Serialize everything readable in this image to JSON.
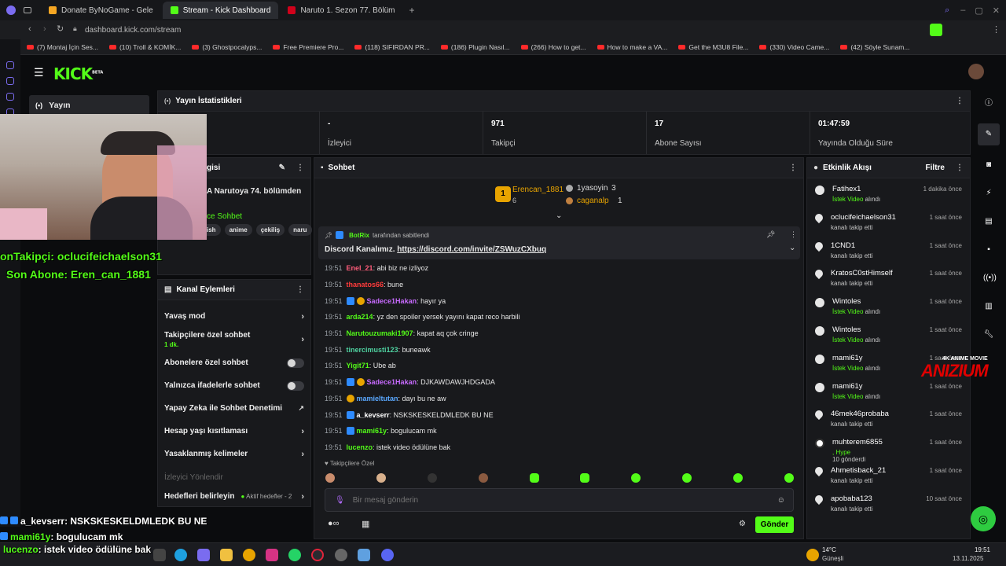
{
  "browser": {
    "tabs": [
      {
        "label": "Donate ByNoGame - Gele",
        "color": "#f5a623"
      },
      {
        "label": "Stream - Kick Dashboard",
        "color": "#53fc18"
      },
      {
        "label": "Naruto 1. Sezon 77. Bölüm",
        "color": "#d0021b"
      }
    ],
    "url": "dashboard.kick.com/stream",
    "bookmarks": [
      "(7) Montaj İçin Ses...",
      "(10) Troll & KOMİK...",
      "(3) Ghostpocalyps...",
      "Free Premiere Pro...",
      "(118) SIFIRDAN PR...",
      "(186) Plugin Nasıl...",
      "(266) How to get...",
      "How to make a VA...",
      "Get the M3U8 File...",
      "(330) Video Came...",
      "(42) Söyle Sunam..."
    ]
  },
  "brand": {
    "logo": "KICK",
    "beta": "BETA",
    "accent": "#53fc18"
  },
  "sidebar": {
    "stream_item": "Yayın"
  },
  "stats_panel": {
    "title": "Yayın İstatistikleri",
    "stats": [
      {
        "value": "-",
        "label": "İzleyici"
      },
      {
        "value": "971",
        "label": "Takipçi"
      },
      {
        "value": "17",
        "label": "Abone Sayısı"
      },
      {
        "value": "01:47:59",
        "label": "Yayında Olduğu Süre"
      }
    ]
  },
  "stream_info": {
    "title_partial": "gisi",
    "stream_title": "A Narutoya 74. bölümden",
    "category": "ce Sohbet",
    "tags": [
      "ish",
      "anime",
      "çekiliş",
      "naru"
    ]
  },
  "overlay": {
    "last_follower": "onTakipçi: oclucifeichaelson31",
    "last_sub": "Son Abone: Eren_can_1881",
    "chat_lines": [
      {
        "user": "a_kevserr",
        "text": ": NSKSKESKELDMLEDK BU NE"
      },
      {
        "user": "mami61y",
        "text": ": bogulucam mk"
      },
      {
        "user": "lucenzo",
        "text": ": istek video ödülüne bak"
      }
    ],
    "watermark_small": "4K ANIME MOVIE",
    "watermark": "ANIZIUM"
  },
  "channel_actions": {
    "title": "Kanal Eylemleri",
    "items": [
      {
        "label": "Yavaş mod",
        "control": "chevron"
      },
      {
        "label": "Takipçilere özel sohbet",
        "sub": "1 dk.",
        "control": "chevron"
      },
      {
        "label": "Abonelere özel sohbet",
        "control": "toggle"
      },
      {
        "label": "Yalnızca ifadelerle sohbet",
        "control": "toggle"
      },
      {
        "label": "Yapay Zeka ile Sohbet Denetimi",
        "control": "link"
      },
      {
        "label": "Hesap yaşı kısıtlaması",
        "control": "chevron"
      },
      {
        "label": "Yasaklanmış kelimeler",
        "control": "chevron"
      }
    ],
    "section_label": "İzleyici Yönlendir",
    "goals_label": "Hedefleri belirleyin",
    "goals_status": "Aktif hedefler - 2"
  },
  "chat": {
    "title": "Sohbet",
    "top_gifters": [
      {
        "rank": "1",
        "name": "Erencan_1881",
        "count": "6"
      },
      {
        "rank": "",
        "name": "1yasoyin",
        "count": "3"
      },
      {
        "rank": "",
        "name": "caganalp",
        "count": "1"
      }
    ],
    "pinned_by": "BotRix",
    "pinned_suffix": "tarafından sabitlendi",
    "pinned_text": "Discord Kanalımız.",
    "pinned_link": "https://discord.com/invite/ZSWuzCXbuq",
    "messages": [
      {
        "time": "19:51",
        "user": "Enel_21",
        "color": "#ff5c7a",
        "text": ": abi biz ne izliyoz",
        "badges": []
      },
      {
        "time": "19:51",
        "user": "thanatos66",
        "color": "#ff3b3b",
        "text": ": bune",
        "badges": []
      },
      {
        "time": "19:51",
        "user": "Sadece1Hakan",
        "color": "#c86bff",
        "text": ": hayır ya",
        "badges": [
          "blue",
          "gold"
        ]
      },
      {
        "time": "19:51",
        "user": "arda214",
        "color": "#53fc18",
        "text": ": yz den spoiler yersek yayını kapat reco harbili",
        "badges": []
      },
      {
        "time": "19:51",
        "user": "Narutouzumaki1907",
        "color": "#53fc18",
        "text": ": kapat aq çok cringe",
        "badges": []
      },
      {
        "time": "19:51",
        "user": "tinercimusti123",
        "color": "#4fd1a0",
        "text": ": buneawk",
        "badges": []
      },
      {
        "time": "19:51",
        "user": "Yigit71",
        "color": "#53fc18",
        "text": ": Ube ab",
        "badges": []
      },
      {
        "time": "19:51",
        "user": "Sadece1Hakan",
        "color": "#c86bff",
        "text": ": DJKAWDAWJHDGADA",
        "badges": [
          "blue",
          "gold"
        ]
      },
      {
        "time": "19:51",
        "user": "mamieltutan",
        "color": "#5aa8ff",
        "text": ": dayı bu ne aw",
        "badges": [
          "gold"
        ]
      },
      {
        "time": "19:51",
        "user": "a_kevserr",
        "color": "#ffffff",
        "text": ": NSKSKESKELDMLEDK BU NE",
        "badges": [
          "blue"
        ]
      },
      {
        "time": "19:51",
        "user": "mami61y",
        "color": "#53fc18",
        "text": ": bogulucam mk",
        "badges": [
          "blue"
        ]
      },
      {
        "time": "19:51",
        "user": "lucenzo",
        "color": "#53fc18",
        "text": ": istek video ödülüne bak",
        "badges": []
      }
    ],
    "followers_only": "Takipçilere Özel",
    "input_placeholder": "Bir mesaj gönderin",
    "send_label": "Gönder"
  },
  "activity": {
    "title": "Etkinlik Akışı",
    "filter": "Filtre",
    "events": [
      {
        "name": "Fatihex1",
        "sub_highlight": "İstek Video",
        "sub": " alındı",
        "time": "1 dakika önce",
        "icon": "redeem"
      },
      {
        "name": "oclucifeichaelson31",
        "sub": "kanalı takip etti",
        "time": "1 saat önce",
        "icon": "heart"
      },
      {
        "name": "1CND1",
        "sub": "kanalı takip etti",
        "time": "1 saat önce",
        "icon": "heart"
      },
      {
        "name": "KratosC0stHimself",
        "sub": "kanalı takip etti",
        "time": "1 saat önce",
        "icon": "heart"
      },
      {
        "name": "Wintoles",
        "sub_highlight": "İstek Video",
        "sub": " alındı",
        "time": "1 saat önce",
        "icon": "redeem"
      },
      {
        "name": "Wintoles",
        "sub_highlight": "İstek Video",
        "sub": " alındı",
        "time": "1 saat önce",
        "icon": "redeem"
      },
      {
        "name": "mami61y",
        "sub_highlight": "İstek Video",
        "sub": " alındı",
        "time": "1 saat önce",
        "icon": "redeem"
      },
      {
        "name": "mami61y",
        "sub_highlight": "İstek Video",
        "sub": " alındı",
        "time": "1 saat önce",
        "icon": "redeem"
      },
      {
        "name": "46mek46probaba",
        "sub": "kanalı takip etti",
        "time": "1 saat önce",
        "icon": "heart"
      },
      {
        "name": "muhterem6855",
        "sub_highlight": ", Hype",
        "sub": "10 gönderdi",
        "time": "1 saat önce",
        "icon": "kick"
      },
      {
        "name": "Ahmetisback_21",
        "sub": "kanalı takip etti",
        "time": "1 saat önce",
        "icon": "heart"
      },
      {
        "name": "apobaba123",
        "sub": "kanalı takip etti",
        "time": "10 saat önce",
        "icon": "heart"
      }
    ]
  },
  "taskbar": {
    "weather_temp": "14°C",
    "weather_desc": "Güneşli",
    "time": "19:51",
    "date": "13.11.2025"
  }
}
